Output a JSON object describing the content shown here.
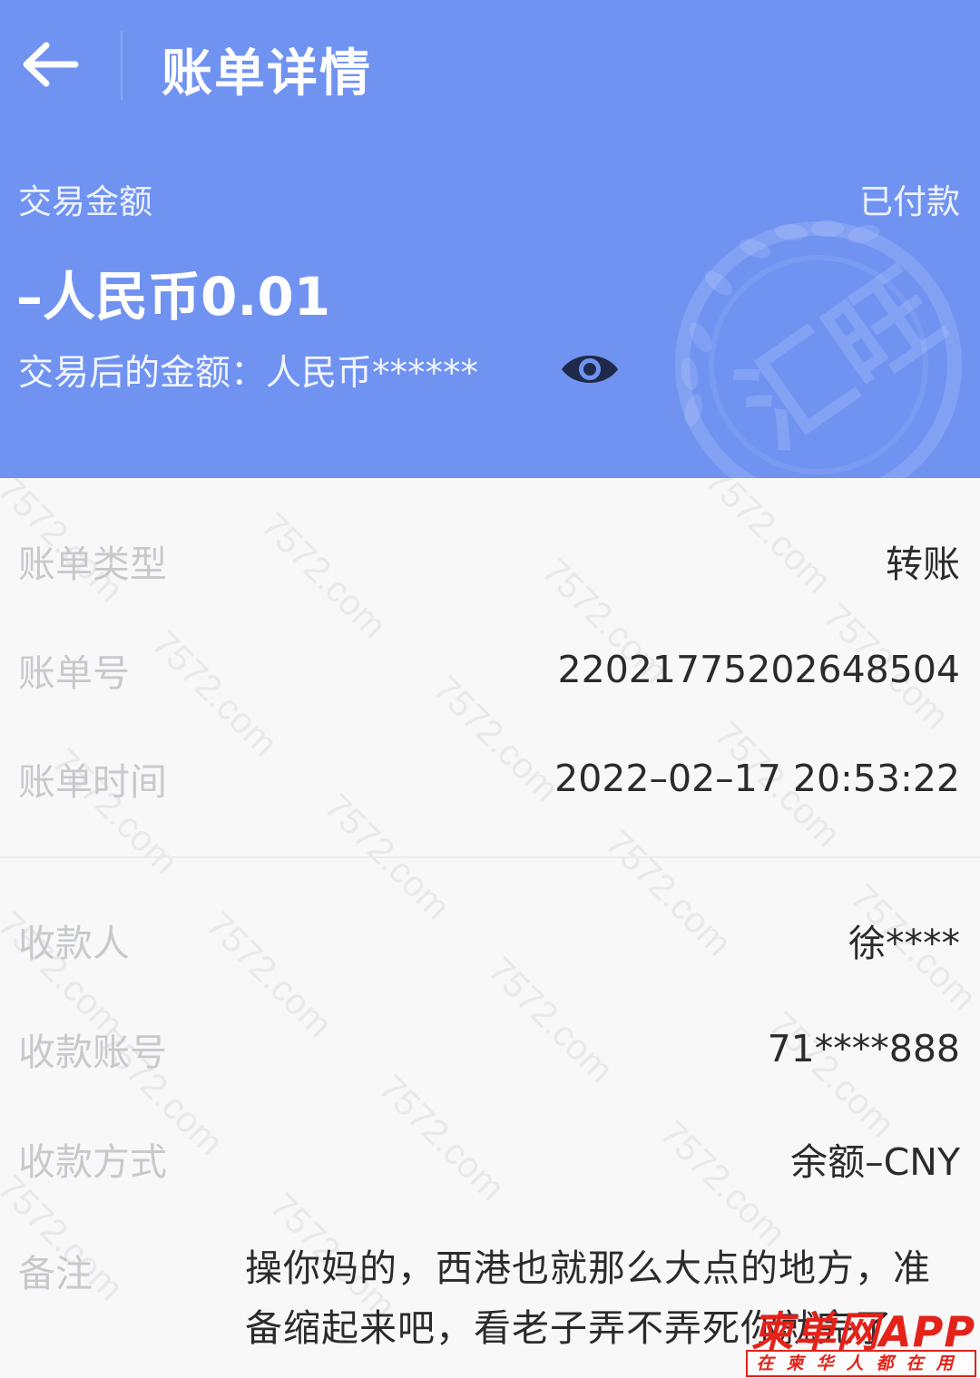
{
  "header": {
    "title": "账单详情",
    "amount_label": "交易金额",
    "status": "已付款",
    "amount": "–人民币0.01",
    "balance_label": "交易后的金额：",
    "balance_value": "人民币******"
  },
  "details": [
    {
      "label": "账单类型",
      "value": "转账"
    },
    {
      "label": "账单号",
      "value": "22021775202648504"
    },
    {
      "label": "账单时间",
      "value": "2022–02–17 20:53:22"
    },
    {
      "label": "收款人",
      "value": "徐****"
    },
    {
      "label": "收款账号",
      "value": "71****888"
    },
    {
      "label": "收款方式",
      "value": "余额–CNY"
    }
  ],
  "note": {
    "label": "备注",
    "text": "操你妈的，西港也就那么大点的地方，准备缩起来吧，看老子弄不弄死你就完了"
  },
  "watermark_text": "7572.com",
  "seal_text": "汇旺",
  "logo": {
    "main": "柬单网APP",
    "sub": "在柬华人都在用"
  },
  "colors": {
    "header_bg": "#7093f2",
    "logo_red": "#e32219"
  }
}
